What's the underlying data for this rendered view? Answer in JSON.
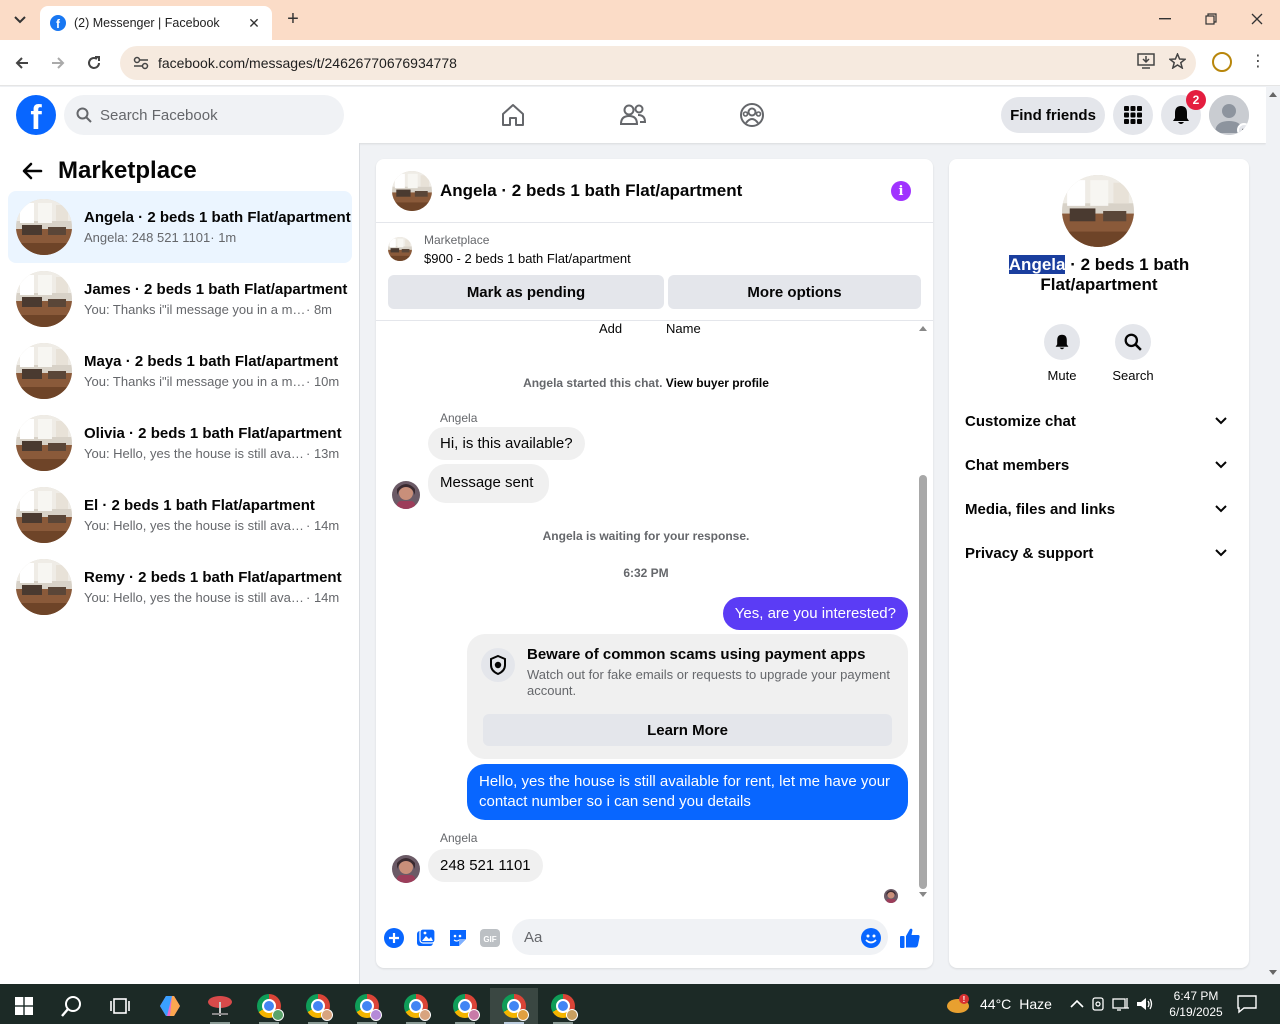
{
  "browser": {
    "tab_title": "(2) Messenger | Facebook",
    "url": "facebook.com/messages/t/24626770676934778"
  },
  "header": {
    "search_placeholder": "Search Facebook",
    "find_friends": "Find friends",
    "notification_count": "2"
  },
  "sidebar": {
    "title": "Marketplace",
    "conversations": [
      {
        "name": "Angela · 2 beds 1 bath Flat/apartment",
        "preview": "Angela: 248 521 1101",
        "time": " · 1m"
      },
      {
        "name": "James · 2 beds 1 bath Flat/apartment",
        "preview": "You: Thanks i\"il message you in a moment",
        "time": " · 8m"
      },
      {
        "name": "Maya · 2 beds 1 bath Flat/apartment",
        "preview": "You: Thanks i\"il message you in a moment",
        "time": " · 10m"
      },
      {
        "name": "Olivia · 2 beds 1 bath Flat/apartment",
        "preview": "You: Hello, yes the house is still available",
        "time": " · 13m"
      },
      {
        "name": "El · 2 beds 1 bath Flat/apartment",
        "preview": "You: Hello, yes the house is still available",
        "time": " · 14m"
      },
      {
        "name": "Remy · 2 beds 1 bath Flat/apartment",
        "preview": "You: Hello, yes the house is still available",
        "time": " · 14m"
      }
    ]
  },
  "chat": {
    "title": "Angela · 2 beds 1 bath Flat/apartment",
    "marketplace_label": "Marketplace",
    "listing": "$900 - 2 beds 1 bath Flat/apartment",
    "mark_pending": "Mark as pending",
    "more_options": "More options",
    "cut_add": "Add",
    "cut_name": "Name",
    "started_text": "Angela started this chat.",
    "view_buyer": "View buyer profile",
    "sender1": "Angela",
    "msg1": "Hi, is this available?",
    "msg2": "Message sent",
    "waiting": "Angela is waiting for your response.",
    "timestamp": "6:32 PM",
    "out1": "Yes, are you interested?",
    "scam_title": "Beware of common scams using payment apps",
    "scam_body": "Watch out for fake emails or requests to upgrade your payment account.",
    "learn_more": "Learn More",
    "out2": "Hello, yes the house is still available for rent, let me have your contact number so i can send you details",
    "sender2": "Angela",
    "msg3": "248 521 1101",
    "composer_placeholder": "Aa"
  },
  "details": {
    "name_highlight": "Angela",
    "title_rest": " · 2 beds 1 bath Flat/apartment",
    "mute": "Mute",
    "search": "Search",
    "items": [
      "Customize chat",
      "Chat members",
      "Media, files and links",
      "Privacy & support"
    ]
  },
  "taskbar": {
    "temperature": "44°C",
    "weather": "Haze",
    "time": "6:47 PM",
    "date": "6/19/2025"
  },
  "colors": {
    "fb_blue": "#0866ff",
    "outgoing_purple": "#5b3cf5",
    "info_purple": "#a033ff",
    "badge_red": "#e41e3f",
    "tab_strip": "#fbdcc7"
  }
}
